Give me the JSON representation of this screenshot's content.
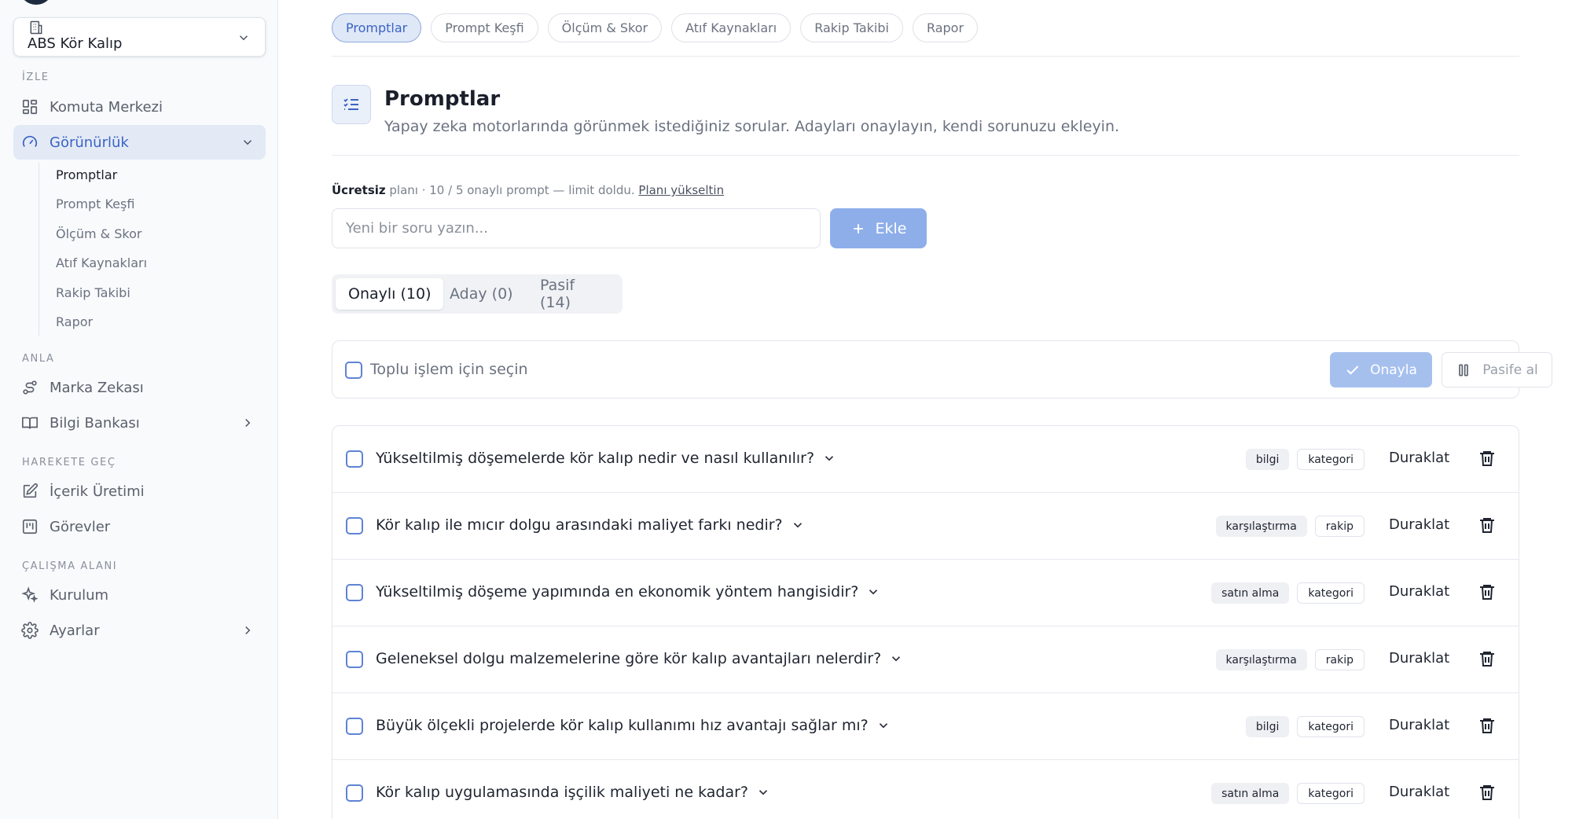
{
  "sidebar": {
    "workspace": "ABS Kör Kalıp",
    "sections": {
      "izle": "İZLE",
      "anla": "ANLA",
      "harekete": "HAREKETE GEÇ",
      "calisma": "ÇALIŞMA ALANI"
    },
    "items": {
      "komuta": "Komuta Merkezi",
      "gorunurluk": "Görünürlük",
      "marka": "Marka Zekası",
      "bilgi": "Bilgi Bankası",
      "icerik": "İçerik Üretimi",
      "gorevler": "Görevler",
      "kurulum": "Kurulum",
      "ayarlar": "Ayarlar"
    },
    "sub_items": [
      "Promptlar",
      "Prompt Keşfi",
      "Ölçüm & Skor",
      "Atıf Kaynakları",
      "Rakip Takibi",
      "Rapor"
    ]
  },
  "tabs": [
    "Promptlar",
    "Prompt Keşfi",
    "Ölçüm & Skor",
    "Atıf Kaynakları",
    "Rakip Takibi",
    "Rapor"
  ],
  "header": {
    "title": "Promptlar",
    "subtitle": "Yapay zeka motorlarında görünmek istediğiniz sorular. Adayları onaylayın, kendi sorunuzu ekleyin."
  },
  "plan": {
    "name": "Ücretsiz",
    "text": "planı · 10 / 5 onaylı prompt — limit doldu.",
    "upgrade": "Planı yükseltin"
  },
  "new_question": {
    "placeholder": "Yeni bir soru yazın...",
    "add_label": "Ekle"
  },
  "segments": [
    "Onaylı (10)",
    "Aday (0)",
    "Pasif (14)"
  ],
  "bulk": {
    "label": "Toplu işlem için seçin",
    "approve": "Onayla",
    "passive": "Pasife al"
  },
  "pause_label": "Duraklat",
  "prompts": [
    {
      "text": "Yükseltilmiş döşemelerde kör kalıp nedir ve nasıl kullanılır?",
      "tag1": "bilgi",
      "tag2": "kategori"
    },
    {
      "text": "Kör kalıp ile mıcır dolgu arasındaki maliyet farkı nedir?",
      "tag1": "karşılaştırma",
      "tag2": "rakip"
    },
    {
      "text": "Yükseltilmiş döşeme yapımında en ekonomik yöntem hangisidir?",
      "tag1": "satın alma",
      "tag2": "kategori"
    },
    {
      "text": "Geleneksel dolgu malzemelerine göre kör kalıp avantajları nelerdir?",
      "tag1": "karşılaştırma",
      "tag2": "rakip"
    },
    {
      "text": "Büyük ölçekli projelerde kör kalıp kullanımı hız avantajı sağlar mı?",
      "tag1": "bilgi",
      "tag2": "kategori"
    },
    {
      "text": "Kör kalıp uygulamasında işçilik maliyeti ne kadar?",
      "tag1": "satın alma",
      "tag2": "kategori"
    }
  ],
  "colors": {
    "accent": "#3b63c4",
    "active_bg": "#e3eaf6",
    "button_disabled": "#8eaeea"
  }
}
